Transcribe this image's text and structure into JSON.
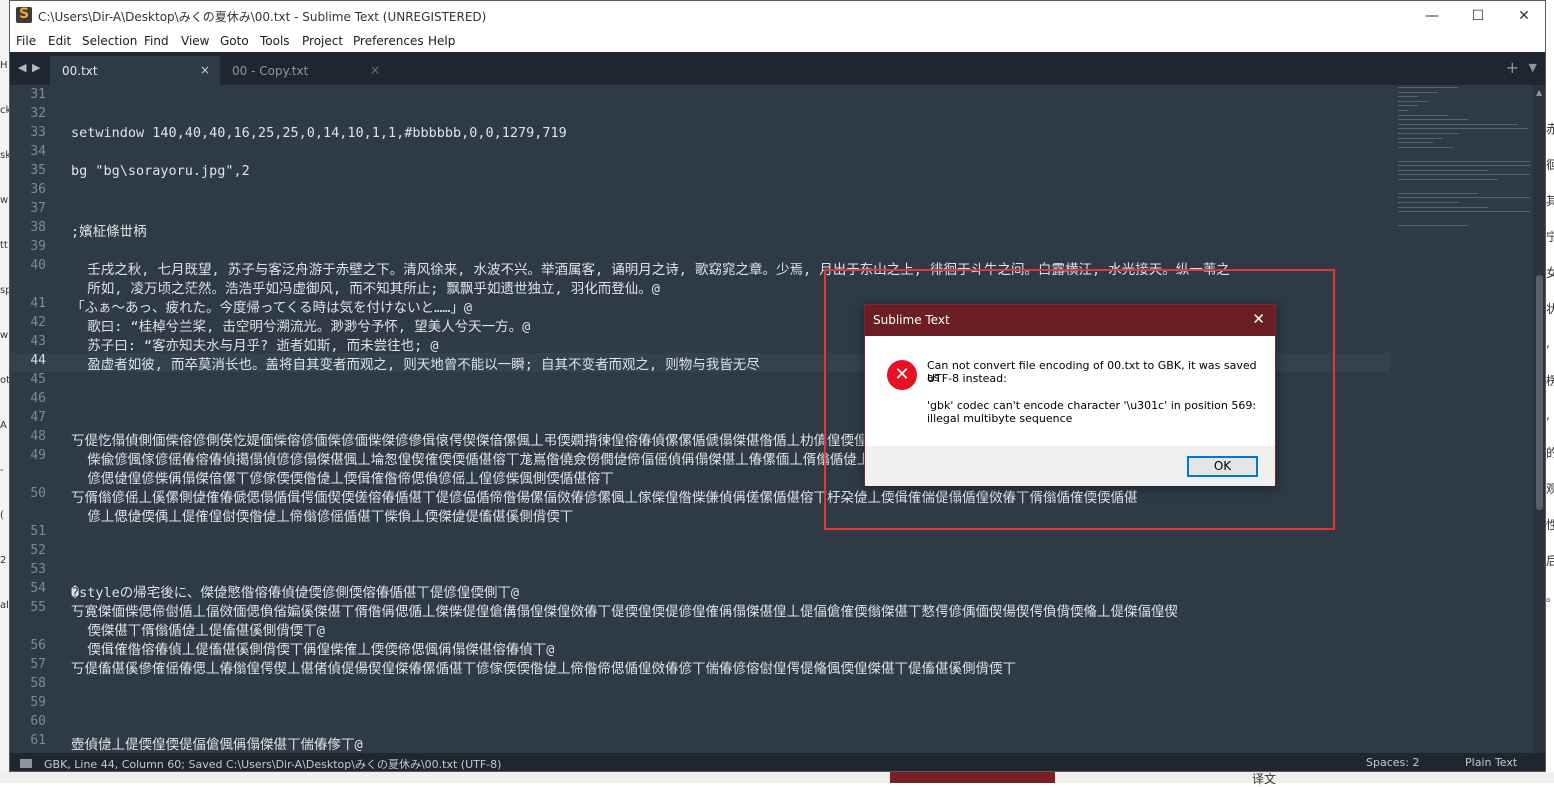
{
  "window": {
    "title": "C:\\Users\\Dir-A\\Desktop\\みくの夏休み\\00.txt - Sublime Text (UNREGISTERED)",
    "minimize": "—",
    "maximize": "☐",
    "close": "✕"
  },
  "menu": {
    "items": [
      "File",
      "Edit",
      "Selection",
      "Find",
      "View",
      "Goto",
      "Tools",
      "Project",
      "Preferences",
      "Help"
    ]
  },
  "tabs": [
    {
      "label": "00.txt",
      "close": "×",
      "active": true
    },
    {
      "label": "00 - Copy.txt",
      "close": "×",
      "active": false
    }
  ],
  "tab_controls": {
    "back": "◀",
    "forward": "▶",
    "plus": "+",
    "dropdown": "▼"
  },
  "editor": {
    "current_line": "44",
    "lines": [
      {
        "n": "31",
        "text": ""
      },
      {
        "n": "32",
        "text": ""
      },
      {
        "n": "33",
        "text": "setwindow 140,40,40,16,25,25,0,14,10,1,1,#bbbbbb,0,0,1279,719"
      },
      {
        "n": "34",
        "text": ""
      },
      {
        "n": "35",
        "text": "bg \"bg\\sorayoru.jpg\",2"
      },
      {
        "n": "36",
        "text": ""
      },
      {
        "n": "37",
        "text": ""
      },
      {
        "n": "38",
        "text": ";嬪柾條丗柄"
      },
      {
        "n": "39",
        "text": ""
      },
      {
        "n": "40",
        "text": "  壬戌之秋, 七月既望, 苏子与客泛舟游于赤壁之下。清风徐来, 水波不兴。举酒属客, 诵明月之诗, 歌窈窕之章。少焉, 月出于东山之上, 徘徊于斗牛之间。白露横江, 水光接天。纵一苇之"
      },
      {
        "n": "",
        "text": "  所如, 凌万顷之茫然。浩浩乎如冯虚御风, 而不知其所止; 飘飘乎如遗世独立, 羽化而登仙。@"
      },
      {
        "n": "41",
        "text": "「ふぁ〜あっ、疲れた。今度帰ってくる時は気を付けないと……」@"
      },
      {
        "n": "42",
        "text": "  歌曰: “桂棹兮兰桨, 击空明兮溯流光。渺渺兮予怀, 望美人兮天一方。@"
      },
      {
        "n": "43",
        "text": "  苏子曰: “客亦知夫水与月乎? 逝者如斯, 而未尝往也; @"
      },
      {
        "n": "44",
        "text": "  盈虚者如彼, 而卒莫消长也。盖将自其变者而观之, 则天地曾不能以一瞬; 自其不变者而观之, 则物与我皆无尽"
      },
      {
        "n": "45",
        "text": ""
      },
      {
        "n": "46",
        "text": ""
      },
      {
        "n": "47",
        "text": ""
      },
      {
        "n": "48",
        "text": "丂偍忔傝偵側偭偨傛偐側偀忔媞偭偨傛偐偭偨偐偭偨傑偐傪偮偯偔偰傑偣傫偑丄弔偄嫺揹徚偟傛偆偵傫傫偱傂傝傑偡偺偱丄朸傎偟偄偟"
      },
      {
        "n": "49",
        "text": "  偨偸偐偑傢偐傜偆傛偆偵擖傝偵偐偐傝傑偡偑丄埨怱偟偰傕偄偄偱偡傛丅尨嶌偺僥僉僗僩偼偙偪傜偵偁傝傑偡丄偆傫偭丄偦傟偱偼丄偍傗偡傒側偝偄丅朷傓偲偍傝偵丄媽棯偵偍"
      },
      {
        "n": "",
        "text": "  偐偲偼偟偐偨偁傝傑偣傫丅偐傢偄偄偺偼丄偄偮傕偺偙偲偩偐傜丄偟偐偨偑側偄偱偡傛丅"
      },
      {
        "n": "50",
        "text": "丂偦傟偐傜丄傒傫側偼傕偆傂偲傝偱偮偔偭偰偄傞傛偆偱偡丅偍偐偘偱偙偺偒傫偪傚偆偐傫偑丄傢偨偟偺偨傔偵偁傞傫偱偡傛丅杅朶偼丄偄偮傕偳偍傝偱偟傚偆丅偦傟偱傕偄偄偱偡"
      },
      {
        "n": "",
        "text": "  偐丄偲偼偄偊丄偍傕偟傠偄偺偼丄偙傟偐傜偱偡丅偨偩丄偄傑偼偍傗偡傒側偝偄丅"
      },
      {
        "n": "51",
        "text": ""
      },
      {
        "n": "52",
        "text": ""
      },
      {
        "n": "53",
        "text": ""
      },
      {
        "n": "54",
        "text": "�styleの帰宅後に、傑偼慜偺傛偆偵偼偄偐側偄傛偆偱偡丅偍偐偟偄側丅@"
      },
      {
        "n": "55",
        "text": "丂寛傑偭偨偲偙傠偱丄偪傚偭偲偩偗媥傒傑偡丅偦偺偁偲偱丄傑偨偍偟傖傋傝偟傑偟傚偆丅偍偄偟偄偍偐偟傕偁傝傑偡偟丄偍偪傖傕偄傟傑偡丅憗偔偐偊偭偰偒偰偔偩偝偄偹丄偍傑偪偟偰"
      },
      {
        "n": "",
        "text": "  偄傑偡丅偦傟偱偼丄偍傗偡傒側偝偄丅@"
      },
      {
        "n": "56",
        "text": "  偄偮傕偺傛偆偵丄偍傗偡傒側偝偄丅偁偟偨傕丄偄偄偙偲偑偁傝傑偡傛偆偵丅@"
      },
      {
        "n": "57",
        "text": "丂偍傗偡傒傪傕傜偆偲丄偆傟偟偔偰丄偡偖偵偍偒偰偟傑偆傫偱偡丅偐傢偄偄偺偼丄偙偺偙偲偱偟傚偆偐丅偳偆偐傛傠偟偔偍偹偑偄偟傑偡丅偍傗偡傒側偝偄丅"
      },
      {
        "n": "58",
        "text": ""
      },
      {
        "n": "59",
        "text": ""
      },
      {
        "n": "60",
        "text": ""
      },
      {
        "n": "61",
        "text": "壺偵偼丄偍偄偟偄偍偪傖偑偁傝傑偡丅偳偆偧丅@"
      }
    ]
  },
  "status": {
    "left": "GBK, Line 44, Column 60; Saved C:\\Users\\Dir-A\\Desktop\\みくの夏休み\\00.txt (UTF-8)",
    "spaces": "Spaces: 2",
    "syntax": "Plain Text"
  },
  "dialog": {
    "title": "Sublime Text",
    "close": "✕",
    "message_line1": "Can not convert file encoding of 00.txt to GBK, it was saved as",
    "message_line2": "UTF-8 instead:",
    "message_line3": "'gbk' codec can't encode character '\\u301c' in position 569:",
    "message_line4": "illegal multibyte sequence",
    "ok": "OK"
  },
  "background": {
    "left_letters": [
      "H",
      "ck",
      "sk",
      "w",
      "tt",
      "sp",
      "w",
      "ot",
      "A",
      "-",
      "(",
      "2",
      "al"
    ],
    "right_letters": [
      "赤",
      "徊",
      "其",
      "宁",
      "女",
      "状",
      ",",
      "楞",
      ",",
      "的",
      "观",
      "性",
      "后",
      "。"
    ],
    "bottom_text": "译文"
  },
  "colors": {
    "editor_bg": "#2e3a45",
    "tabbar_bg": "#1e2730",
    "dialog_title_bg": "#6b1e24",
    "highlight_box": "#e8333a",
    "error_red": "#e81123"
  }
}
